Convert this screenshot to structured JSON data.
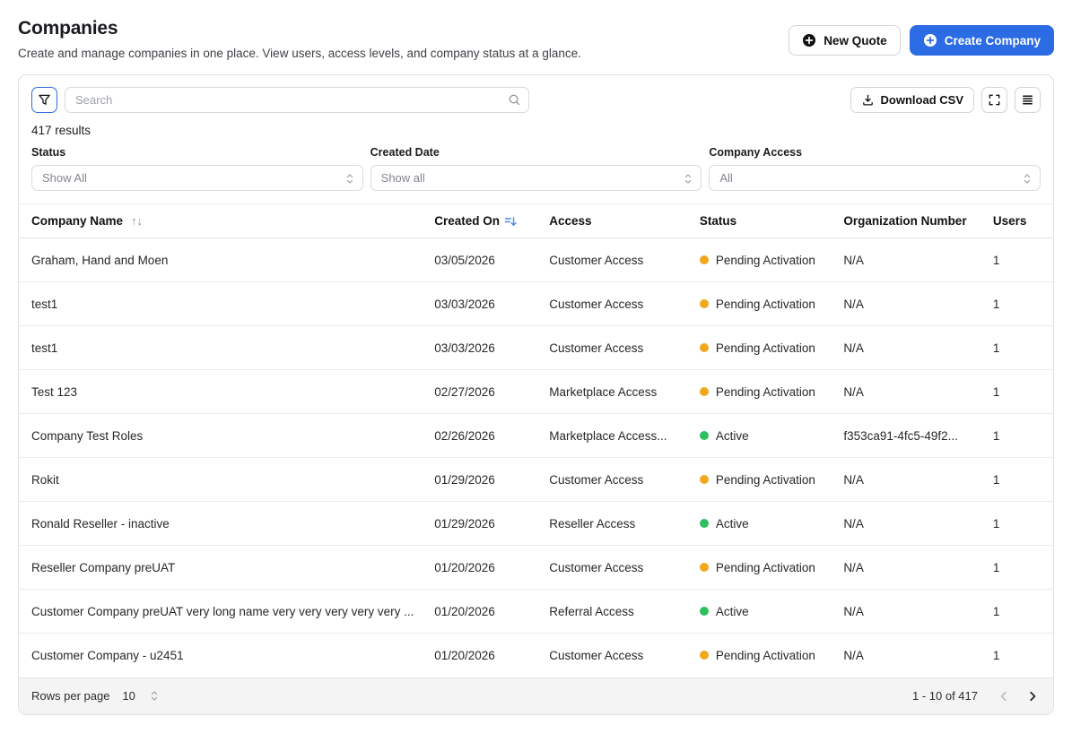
{
  "page": {
    "title": "Companies",
    "subtitle": "Create and manage companies in one place. View users, access levels, and company status at a glance."
  },
  "actions": {
    "new_quote": "New Quote",
    "create_company": "Create Company"
  },
  "toolbar": {
    "search_placeholder": "Search",
    "download_csv": "Download CSV",
    "results_count": "417 results"
  },
  "filters": {
    "status": {
      "label": "Status",
      "value": "Show All"
    },
    "created_date": {
      "label": "Created Date",
      "value": "Show all"
    },
    "company_access": {
      "label": "Company Access",
      "value": "All"
    }
  },
  "table": {
    "columns": {
      "name": "Company Name",
      "created": "Created On",
      "access": "Access",
      "status": "Status",
      "org": "Organization Number",
      "users": "Users"
    },
    "rows": [
      {
        "name": "Graham, Hand and Moen",
        "created": "03/05/2026",
        "access": "Customer Access",
        "status": "Pending Activation",
        "status_type": "pending",
        "org": "N/A",
        "users": "1"
      },
      {
        "name": "test1",
        "created": "03/03/2026",
        "access": "Customer Access",
        "status": "Pending Activation",
        "status_type": "pending",
        "org": "N/A",
        "users": "1"
      },
      {
        "name": "test1",
        "created": "03/03/2026",
        "access": "Customer Access",
        "status": "Pending Activation",
        "status_type": "pending",
        "org": "N/A",
        "users": "1"
      },
      {
        "name": "Test 123",
        "created": "02/27/2026",
        "access": "Marketplace Access",
        "status": "Pending Activation",
        "status_type": "pending",
        "org": "N/A",
        "users": "1"
      },
      {
        "name": "Company Test Roles",
        "created": "02/26/2026",
        "access": "Marketplace Access...",
        "status": "Active",
        "status_type": "active",
        "org": "f353ca91-4fc5-49f2...",
        "users": "1"
      },
      {
        "name": "Rokit",
        "created": "01/29/2026",
        "access": "Customer Access",
        "status": "Pending Activation",
        "status_type": "pending",
        "org": "N/A",
        "users": "1"
      },
      {
        "name": "Ronald Reseller - inactive",
        "created": "01/29/2026",
        "access": "Reseller Access",
        "status": "Active",
        "status_type": "active",
        "org": "N/A",
        "users": "1"
      },
      {
        "name": "Reseller Company preUAT",
        "created": "01/20/2026",
        "access": "Customer Access",
        "status": "Pending Activation",
        "status_type": "pending",
        "org": "N/A",
        "users": "1"
      },
      {
        "name": "Customer Company preUAT very long name very very very very very ...",
        "created": "01/20/2026",
        "access": "Referral Access",
        "status": "Active",
        "status_type": "active",
        "org": "N/A",
        "users": "1"
      },
      {
        "name": "Customer Company - u2451",
        "created": "01/20/2026",
        "access": "Customer Access",
        "status": "Pending Activation",
        "status_type": "pending",
        "org": "N/A",
        "users": "1"
      }
    ]
  },
  "status_colors": {
    "pending": "#f0a81c",
    "active": "#2fbe60"
  },
  "pagination": {
    "rows_per_page_label": "Rows per page",
    "rows_per_page": "10",
    "range": "1 - 10 of 417"
  },
  "colors": {
    "accent": "#2b6be4"
  }
}
